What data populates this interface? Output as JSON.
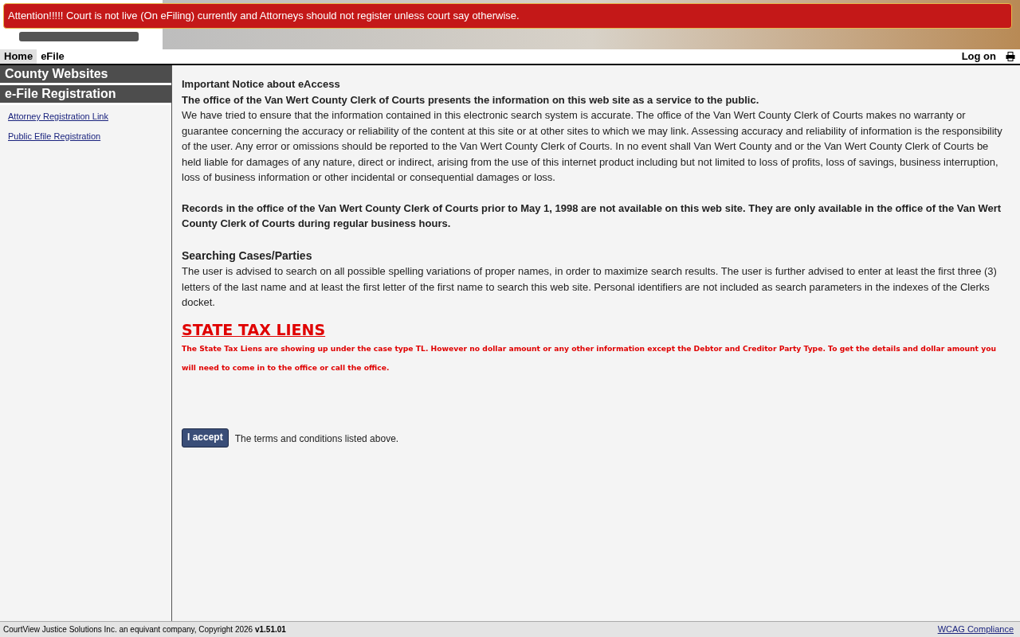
{
  "alert": "Attention!!!!! Court is not live (On eFiling) currently and Attorneys should not register unless court say otherwise.",
  "nav": {
    "tabs": [
      {
        "label": "Home",
        "selected": true
      },
      {
        "label": "eFile",
        "selected": false
      }
    ],
    "logon": "Log on"
  },
  "sidebar": {
    "sections": [
      {
        "title": "County Websites"
      },
      {
        "title": "e-File Registration",
        "links": [
          "Attorney Registration Link",
          "Public Efile Registration"
        ]
      }
    ]
  },
  "notice": {
    "title": "Important Notice about eAccess",
    "lead": "The office of the Van Wert County Clerk of Courts presents the information on this web site as a service to the public.",
    "body": "We have tried to ensure that the information contained in this electronic search system is accurate. The office of the Van Wert County Clerk of Courts makes no warranty or guarantee concerning the accuracy or reliability of the content at this site or at other sites to which we may link. Assessing accuracy and reliability of information is the responsibility of the user. Any error or omissions should be reported to the Van Wert County Clerk of Courts. In no event shall Van Wert County and or the Van Wert County Clerk of Courts be held liable for damages of any nature, direct or indirect, arising from the use of this internet product including but not limited to loss of profits, loss of savings, business interruption, loss of business information or other incidental or consequential damages or loss.",
    "records": "Records in the office of the Van Wert County Clerk of Courts prior to May 1, 1998 are not available on this web site. They are only available in the office of the Van Wert County Clerk of Courts during regular business hours.",
    "search_title": "Searching Cases/Parties",
    "search_body": "The user is advised to search on all possible spelling variations of proper names, in order to maximize search results. The user is further advised to enter at least the first three (3) letters of the last name and at least the first letter of the first name to search this web site. Personal identifiers are not included as search parameters in the indexes of the Clerks docket.",
    "liens_title": "STATE TAX LIENS",
    "liens_body": "The State Tax Liens are showing up under the case type TL. However no dollar amount or any other information except the Debtor and Creditor Party Type. To get the details and dollar amount you will need to come in to the office or call the office."
  },
  "accept": {
    "button": "I accept",
    "text": "The terms and conditions listed above."
  },
  "footer": {
    "copyright": "CourtView Justice Solutions Inc. an equivant company, Copyright 2026 **v1.51.01**",
    "link": "WCAG Compliance"
  }
}
